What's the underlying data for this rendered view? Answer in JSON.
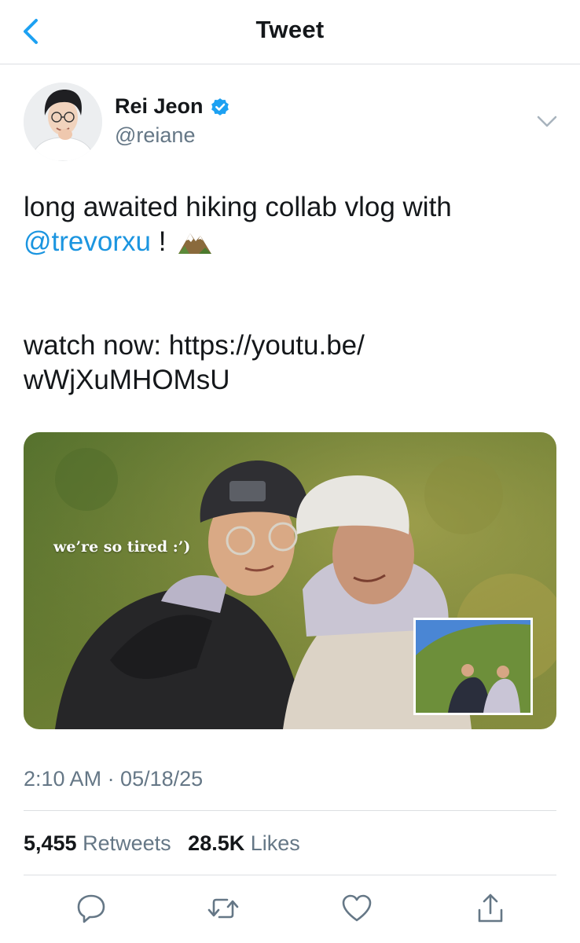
{
  "nav": {
    "title": "Tweet",
    "back_icon": "chevron-left-icon",
    "accent_color": "#1da1f2"
  },
  "author": {
    "name": "Rei Jeon",
    "handle": "@reiane",
    "verified": true,
    "verified_icon": "verified-badge-icon"
  },
  "tweet": {
    "line1": "long awaited hiking collab vlog with",
    "mention": "@trevorxu",
    "after_mention": " ! ",
    "emoji": "mountain-emoji-icon",
    "line3": "watch now: https://youtu.be/",
    "line4": "wWjXuMHOMsU"
  },
  "media": {
    "caption": "we’re so tired  :’)"
  },
  "meta": {
    "timestamp": "2:10 AM · 05/18/25"
  },
  "stats": {
    "retweets_count": "5,455",
    "retweets_label": "Retweets",
    "likes_count": "28.5K",
    "likes_label": "Likes"
  },
  "actions": [
    "reply-icon",
    "retweet-icon",
    "like-icon",
    "share-icon"
  ],
  "colors": {
    "link": "#1b95e0",
    "secondary_text": "#657786",
    "divider": "#dcdfe2"
  }
}
